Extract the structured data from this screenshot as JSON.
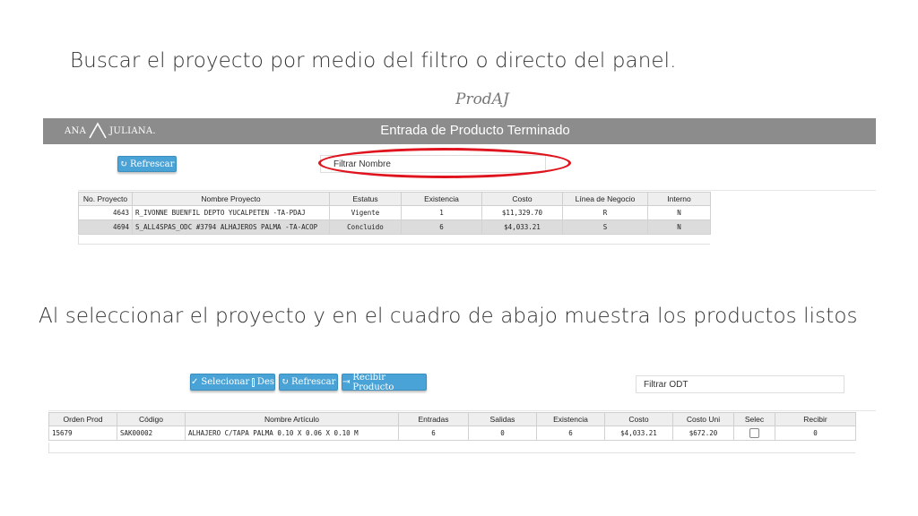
{
  "slide": {
    "heading_1": "Buscar el proyecto por medio del filtro o directo del panel.",
    "heading_2": "Al seleccionar el proyecto y en el cuadro de abajo muestra los productos listos",
    "brand": "ProdAJ"
  },
  "app": {
    "logo_left": "ANA",
    "logo_right": "JULIANA.",
    "title": "Entrada de Producto Terminado",
    "header_color": "#8c8c8c",
    "highlight_color": "#e0141e"
  },
  "projects_panel": {
    "refresh_label": "Refrescar",
    "filter_value": "Filtrar Nombre",
    "columns": [
      "No. Proyecto",
      "Nombre Proyecto",
      "Estatus",
      "Existencia",
      "Costo",
      "Línea de Negocio",
      "Interno"
    ],
    "rows": [
      [
        "4643",
        "R_IVONNE BUENFIL DEPTO YUCALPETEN -TA-PDAJ",
        "Vigente",
        "1",
        "$11,329.70",
        "R",
        "N"
      ],
      [
        "4694",
        "S_ALL4SPAS_ODC #3794 ALHAJEROS PALMA -TA-ACOP",
        "Concluido",
        "6",
        "$4,033.21",
        "S",
        "N"
      ]
    ]
  },
  "products_panel": {
    "select_label": "Selecionar",
    "deselect_label": "Des",
    "refresh_label": "Refrescar",
    "receive_label": "Recibir Producto",
    "filter_value": "Filtrar ODT",
    "columns": [
      "Orden Prod",
      "Código",
      "Nombre Artículo",
      "Entradas",
      "Salidas",
      "Existencia",
      "Costo",
      "Costo Uni",
      "Selec",
      "Recibir"
    ],
    "rows": [
      [
        "15679",
        "SAK00002",
        "ALHAJERO C/TAPA PALMA 0.10 X 0.06 X 0.10 M",
        "6",
        "0",
        "6",
        "$4,033.21",
        "$672.20",
        "",
        "0"
      ]
    ],
    "button_color": "#4aa3d6"
  }
}
